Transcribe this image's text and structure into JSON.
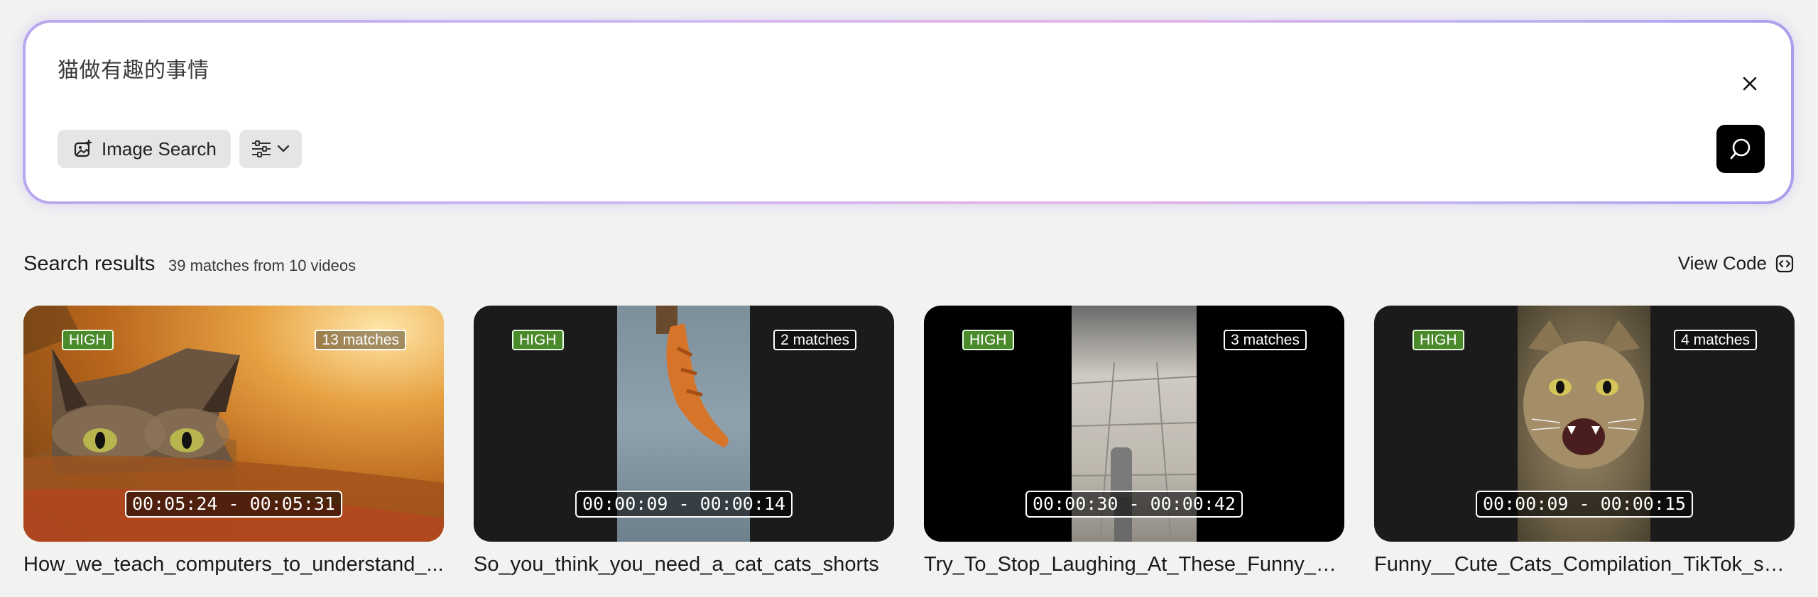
{
  "search": {
    "query": "猫做有趣的事情",
    "image_search_label": "Image Search",
    "icons": [
      "image-search-icon",
      "filter-sliders-icon",
      "chevron-down-icon",
      "close-icon",
      "search-submit-icon"
    ]
  },
  "results": {
    "title": "Search results",
    "count_text": "39 matches from 10 videos",
    "view_code_label": "View Code"
  },
  "cards": [
    {
      "confidence": "HIGH",
      "matches": "13 matches",
      "timecode": "00:05:24 - 00:05:31",
      "title": "How_we_teach_computers_to_understand_..."
    },
    {
      "confidence": "HIGH",
      "matches": "2 matches",
      "timecode": "00:00:09 - 00:00:14",
      "title": "So_you_think_you_need_a_cat_cats_shorts"
    },
    {
      "confidence": "HIGH",
      "matches": "3 matches",
      "timecode": "00:00:30 - 00:00:42",
      "title": "Try_To_Stop_Laughing_At_These_Funny_Cat..."
    },
    {
      "confidence": "HIGH",
      "matches": "4 matches",
      "timecode": "00:00:09 - 00:00:15",
      "title": "Funny__Cute_Cats_Compilation_TikTok_sho..."
    }
  ],
  "colors": {
    "accent_gradient_start": "#b9a7ef",
    "accent_gradient_mid": "#e7b6e6",
    "high_badge": "#4a8a2a",
    "submit_button": "#000000"
  }
}
